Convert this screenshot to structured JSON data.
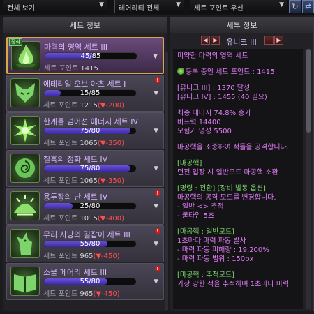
{
  "filters": {
    "view": "전체 보기",
    "rarity": "레어리티 전체",
    "sort": "세트 포인트 우선"
  },
  "left_panel": {
    "title": "세트 정보",
    "equipped_badge": "장착",
    "cards": [
      {
        "name": "마력의 영역 세트 III",
        "progress": "45/85",
        "progress_fraction": 0.53,
        "sp_label": "세트 포인트",
        "sp_value": "1415",
        "sp_delta": ""
      },
      {
        "name": "에테리얼 오브 아츠 세트 I",
        "progress": "15/85",
        "progress_fraction": 0.18,
        "sp_label": "세트 포인트",
        "sp_value": "1215",
        "sp_delta": "(▼-200)"
      },
      {
        "name": "한계를 넘어선 에너지 세트 IV",
        "progress": "75/80",
        "progress_fraction": 0.94,
        "sp_label": "세트 포인트",
        "sp_value": "1065",
        "sp_delta": "(▼-350)"
      },
      {
        "name": "칠흑의 정화 세트 IV",
        "progress": "75/80",
        "progress_fraction": 0.94,
        "sp_label": "세트 포인트",
        "sp_value": "1065",
        "sp_delta": "(▼-350)"
      },
      {
        "name": "용투장의 난 세트 IV",
        "progress": "25/80",
        "progress_fraction": 0.31,
        "sp_label": "세트 포인트",
        "sp_value": "1015",
        "sp_delta": "(▼-400)"
      },
      {
        "name": "무리 사냥의 길잡이 세트 III",
        "progress": "55/80",
        "progress_fraction": 0.69,
        "sp_label": "세트 포인트",
        "sp_value": "965",
        "sp_delta": "(▼-450)"
      },
      {
        "name": "소울 페어리 세트 III",
        "progress": "55/80",
        "progress_fraction": 0.69,
        "sp_label": "세트 포인트",
        "sp_value": "965",
        "sp_delta": "(▼-450)"
      }
    ]
  },
  "right_panel": {
    "title": "세부 정보",
    "nav_label": "유니크 III",
    "lines": [
      {
        "text": "미약한 마력의 영역 세트",
        "cls": "pink"
      },
      {
        "text": "",
        "cls": "sep"
      },
      {
        "text": "등록 중인 세트 포인트 : 1415",
        "cls": "reg"
      },
      {
        "text": "",
        "cls": "sep"
      },
      {
        "text": "[유니크 III] : 1370 달성",
        "cls": "pink"
      },
      {
        "text": "[유니크 IV] : 1455 (40 필요)",
        "cls": "pink"
      },
      {
        "text": "",
        "cls": "sep"
      },
      {
        "text": "최종 데미지 74.8% 증가",
        "cls": "pink"
      },
      {
        "text": "버프력 14400",
        "cls": "pink"
      },
      {
        "text": "모험가 명성 5500",
        "cls": "pink"
      },
      {
        "text": "",
        "cls": "sep"
      },
      {
        "text": "마공핵을 조종하여 적들을 공격합니다.",
        "cls": "pink"
      },
      {
        "text": "",
        "cls": "sep"
      },
      {
        "text": "[마공핵]",
        "cls": "green"
      },
      {
        "text": "던전 입장 시 일반모드 마공핵 소환",
        "cls": "pink"
      },
      {
        "text": "",
        "cls": "sep"
      },
      {
        "text": "[명령 : 전환] [장비 발동 옵션]",
        "cls": "green"
      },
      {
        "text": "마공핵의 공격 모드를 변경합니다.",
        "cls": "pink"
      },
      {
        "text": "- 일반 <> 추적",
        "cls": "pink"
      },
      {
        "text": "- 쿨타임 5초",
        "cls": "pink"
      },
      {
        "text": "",
        "cls": "sep"
      },
      {
        "text": "[마공핵 : 일반모드]",
        "cls": "green"
      },
      {
        "text": "1초마다 마력 파동 발사",
        "cls": "pink"
      },
      {
        "text": "- 마력 파동 피해량 : 19,200%",
        "cls": "pink"
      },
      {
        "text": "- 마력 파동 범위 : 150px",
        "cls": "pink"
      },
      {
        "text": "",
        "cls": "sep"
      },
      {
        "text": "[마공핵 : 추적모드]",
        "cls": "green"
      },
      {
        "text": "가장 강한 적을 추적하며 1초마다 마력",
        "cls": "pink"
      }
    ]
  }
}
